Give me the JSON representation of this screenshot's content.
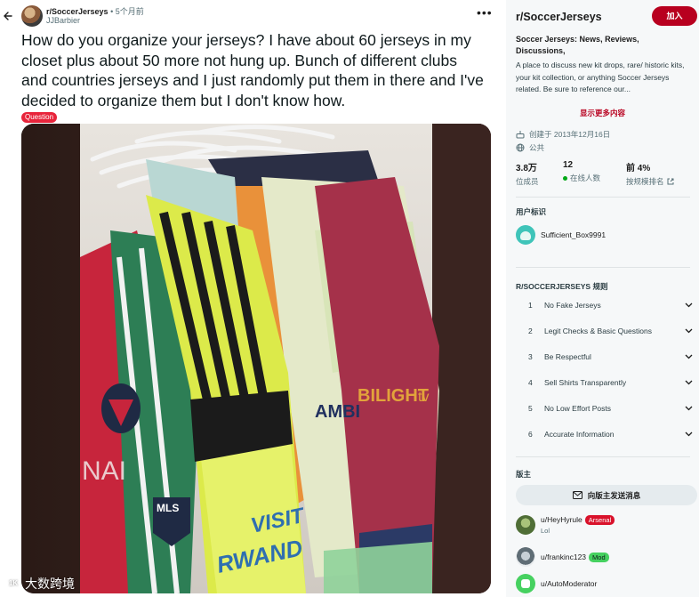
{
  "post": {
    "subreddit": "r/SoccerJerseys",
    "separator": "•",
    "time": "5个月前",
    "author": "JJBarbier",
    "title": "How do you organize your jerseys? I have about 60 jerseys in my closet plus about 50 more not hung up. Bunch of different clubs and countries jerseys and I just randomly put them in there and I've decided to organize them but I don't know how.",
    "flair": "Question",
    "flair_color": "#e8243b",
    "more_icon": "more-horizontal-icon",
    "back_icon": "back-arrow-icon",
    "image_text": {
      "ambi": "AMBI",
      "bilight": "BILIGHT",
      "tv": "tv",
      "visit": "VISIT",
      "rwanda": "RWAND",
      "mls": "MLS",
      "nai": "NAI"
    }
  },
  "watermark": {
    "logo": "1K",
    "text": "大数跨境"
  },
  "sidebar": {
    "name": "r/SoccerJerseys",
    "join_label": "加入",
    "join_color": "#b8001f",
    "description_title": "Soccer Jerseys: News, Reviews, Discussions,",
    "description": "A place to discuss new kit drops, rare/ historic kits, your kit collection, or anything Soccer Jerseys related. Be sure to reference our...",
    "show_more": "显示更多内容",
    "created": "创建于 2013年12月16日",
    "visibility": "公共",
    "stats": [
      {
        "value": "3.8万",
        "label": "位成员"
      },
      {
        "value": "12",
        "label": "在线人数"
      },
      {
        "value": "前 4%",
        "label": "按规模排名"
      }
    ],
    "user_flair_heading": "用户标识",
    "user_flair_name": "Sufficient_Box9991",
    "rules_heading": "R/SOCCERJERSEYS 规则",
    "rules": [
      {
        "num": "1",
        "text": "No Fake Jerseys"
      },
      {
        "num": "2",
        "text": "Legit Checks & Basic Questions"
      },
      {
        "num": "3",
        "text": "Be Respectful"
      },
      {
        "num": "4",
        "text": "Sell Shirts Transparently"
      },
      {
        "num": "5",
        "text": "No Low Effort Posts"
      },
      {
        "num": "6",
        "text": "Accurate Information"
      }
    ],
    "mods_heading": "版主",
    "message_mods": "向版主发送消息",
    "moderators": [
      {
        "name": "u/HeyHyrule",
        "flair": "Arsenal",
        "flair_bg": "#d9122b",
        "flair_fg": "#ffffff",
        "sub": "Lol"
      },
      {
        "name": "u/frankinc123",
        "flair": "Mod",
        "flair_bg": "#46d160",
        "flair_fg": "#0f1a1c",
        "sub": ""
      },
      {
        "name": "u/AutoModerator",
        "flair": "",
        "sub": ""
      }
    ]
  }
}
